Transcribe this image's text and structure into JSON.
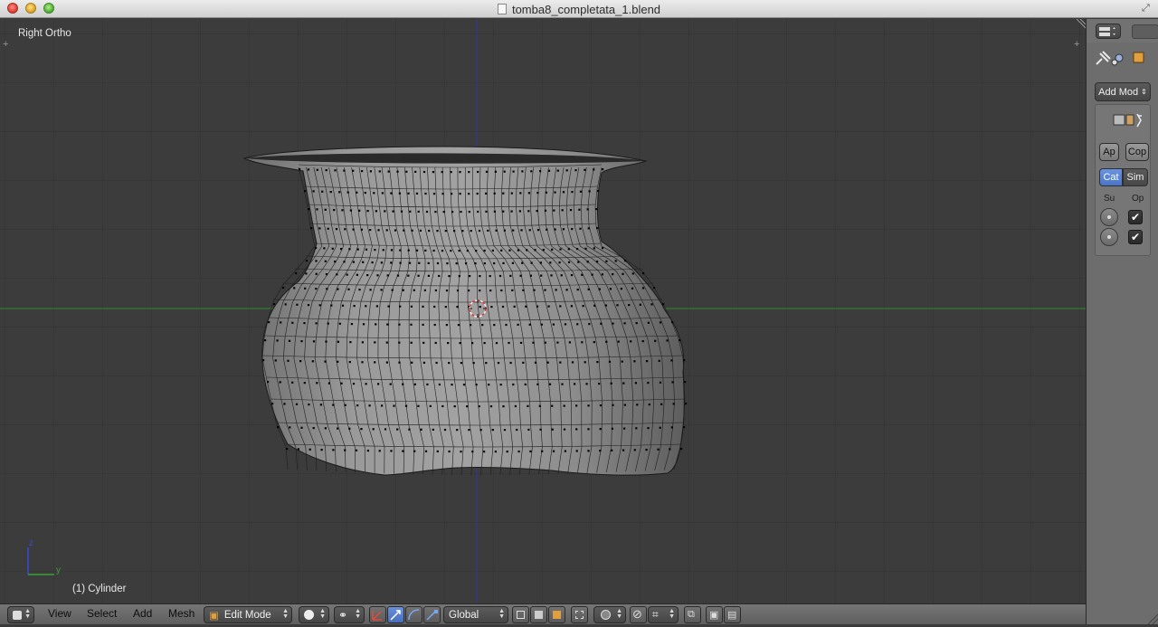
{
  "window": {
    "title": "tomba8_completata_1.blend"
  },
  "viewport": {
    "view_name": "Right Ortho",
    "object_label": "(1) Cylinder",
    "axis_labels": {
      "z": "z",
      "y": "y"
    },
    "colors": {
      "x_axis": "#2f8a2f",
      "z_axis": "#2f36a6",
      "mesh": "#8c8c8c",
      "background": "#3c3c3c"
    }
  },
  "properties": {
    "add_modifier_label": "Add Mod",
    "apply_label": "Ap",
    "copy_label": "Cop",
    "tabs": [
      "Cat",
      "Sim"
    ],
    "active_tab": "Cat",
    "col_labels": [
      "Su",
      "Op"
    ]
  },
  "header": {
    "menus": [
      "View",
      "Select",
      "Add",
      "Mesh"
    ],
    "mode": "Edit Mode",
    "orientation": "Global"
  }
}
